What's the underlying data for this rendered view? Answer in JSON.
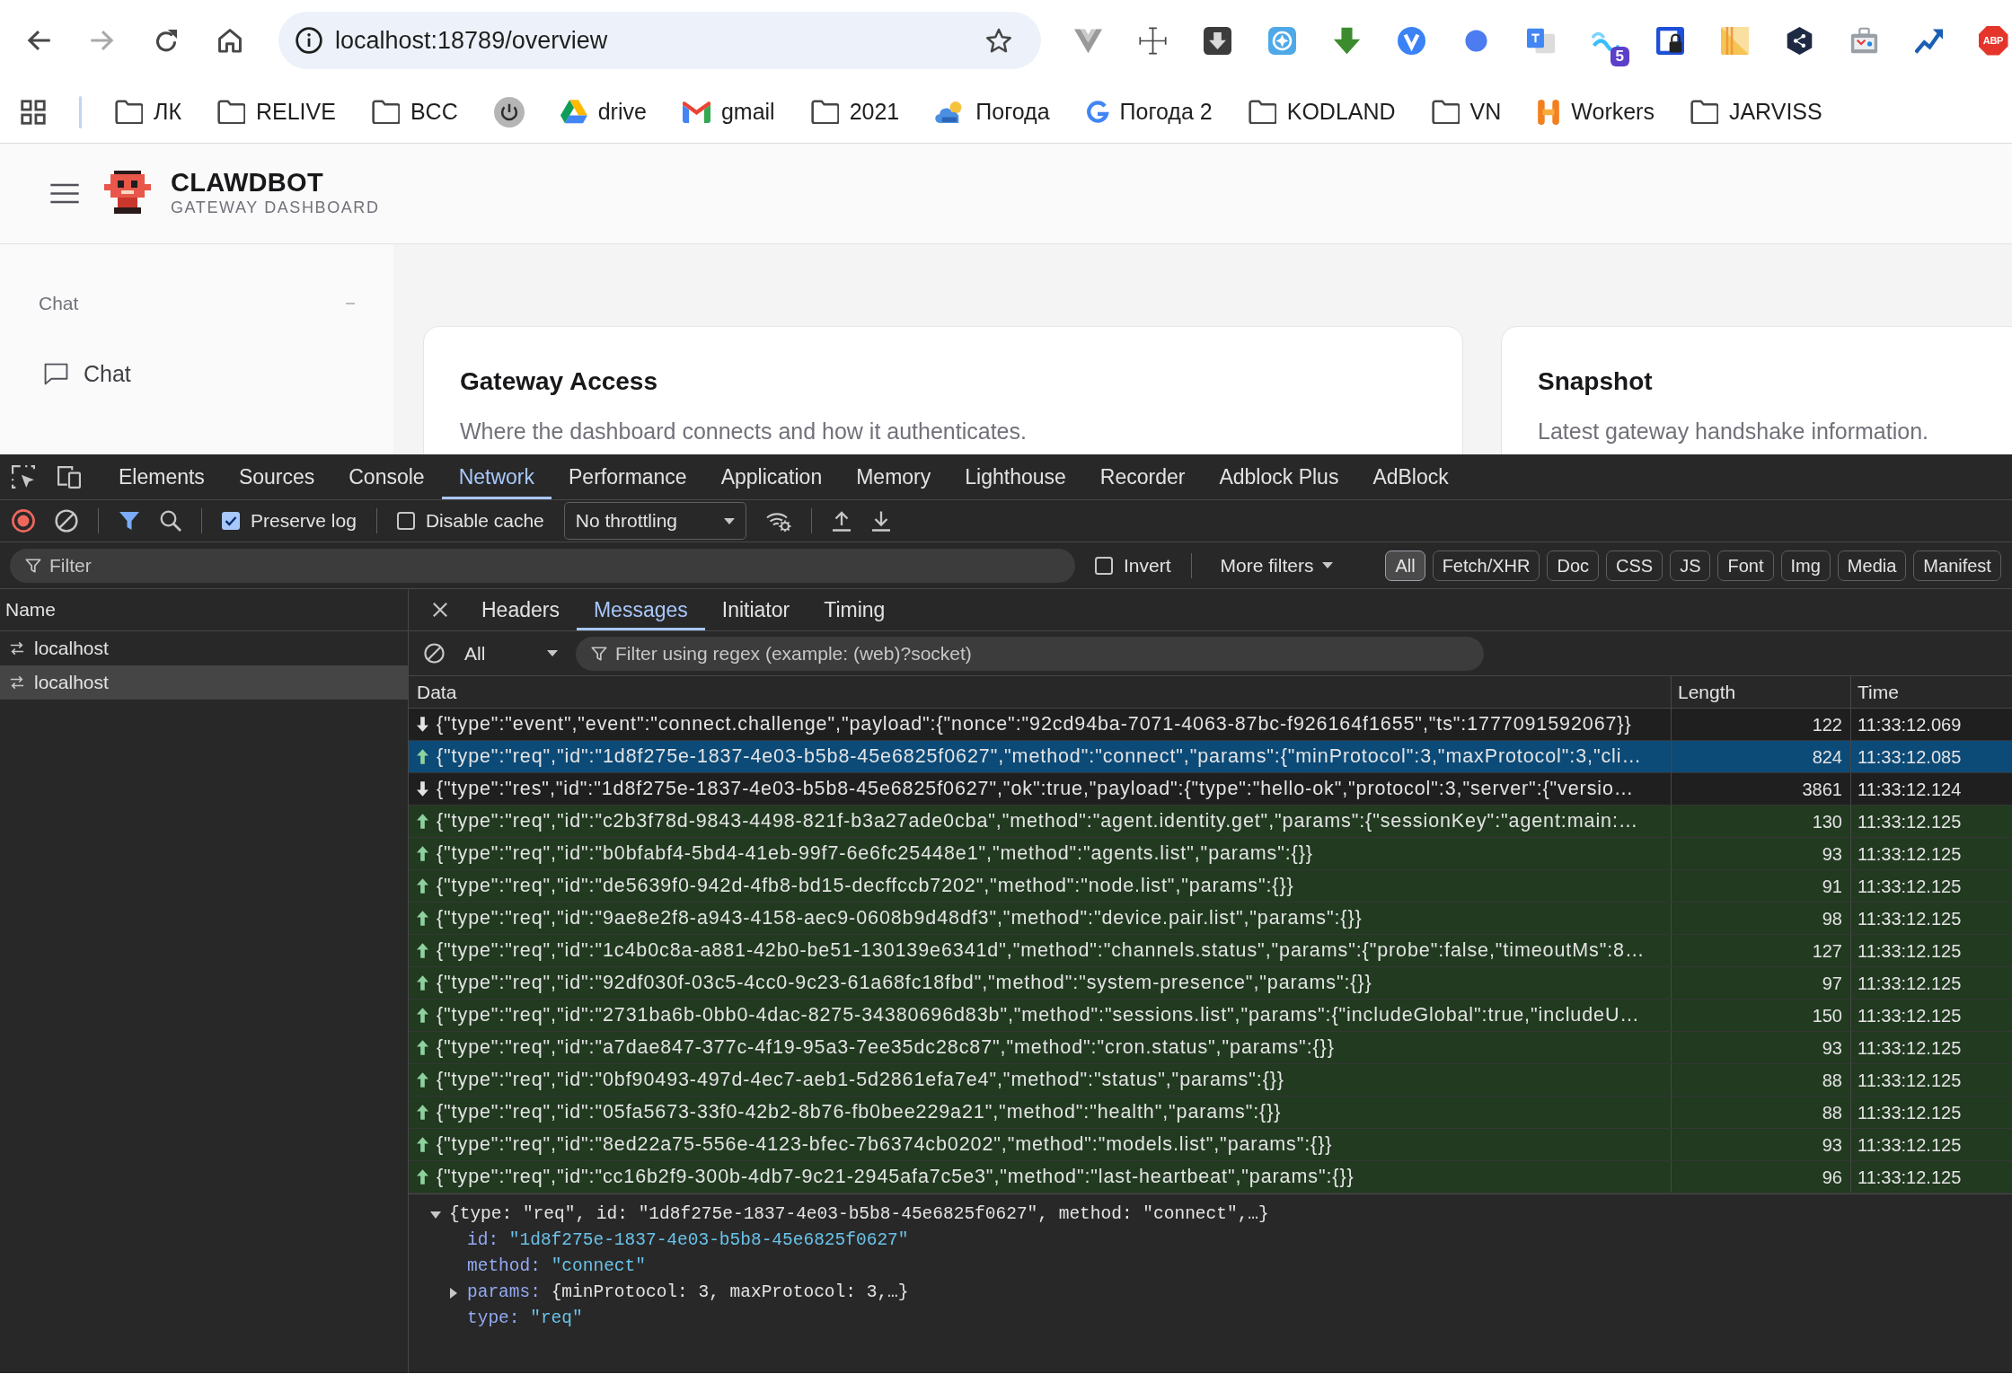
{
  "browser": {
    "url": "localhost:18789/overview",
    "extensions": [
      {
        "kind": "vue"
      },
      {
        "kind": "move"
      },
      {
        "kind": "download-box"
      },
      {
        "kind": "compass"
      },
      {
        "kind": "green-arrow"
      },
      {
        "kind": "v-circle"
      },
      {
        "kind": "blue-dot"
      },
      {
        "kind": "translate"
      },
      {
        "kind": "wave",
        "badge": "5"
      },
      {
        "kind": "lock"
      },
      {
        "kind": "notes"
      },
      {
        "kind": "hexagon"
      },
      {
        "kind": "toolbox"
      },
      {
        "kind": "chart"
      },
      {
        "kind": "abp",
        "label": "ABP"
      }
    ],
    "bookmarks": [
      {
        "kind": "folder",
        "label": "ЛК"
      },
      {
        "kind": "folder",
        "label": "RELIVE"
      },
      {
        "kind": "folder",
        "label": "BCC"
      },
      {
        "kind": "power"
      },
      {
        "kind": "drive",
        "label": "drive"
      },
      {
        "kind": "gmail",
        "label": "gmail"
      },
      {
        "kind": "folder",
        "label": "2021"
      },
      {
        "kind": "weather",
        "label": "Погода"
      },
      {
        "kind": "google",
        "label": "Погода 2"
      },
      {
        "kind": "folder",
        "label": "KODLAND"
      },
      {
        "kind": "folder",
        "label": "VN"
      },
      {
        "kind": "workers",
        "label": "Workers"
      },
      {
        "kind": "folder",
        "label": "JARVISS"
      }
    ]
  },
  "app": {
    "brand": {
      "title": "CLAWDBOT",
      "subtitle": "GATEWAY DASHBOARD"
    },
    "sidebar": {
      "groups": [
        {
          "label": "Chat",
          "expanded": true,
          "items": [
            {
              "label": "Chat",
              "selected": false
            }
          ]
        }
      ]
    },
    "cards": [
      {
        "title": "Gateway Access",
        "subtitle": "Where the dashboard connects and how it authenticates."
      },
      {
        "title": "Snapshot",
        "subtitle": "Latest gateway handshake information."
      }
    ]
  },
  "devtools": {
    "tabs": [
      {
        "label": "Elements",
        "selected": false
      },
      {
        "label": "Sources",
        "selected": false
      },
      {
        "label": "Console",
        "selected": false
      },
      {
        "label": "Network",
        "selected": true
      },
      {
        "label": "Performance",
        "selected": false
      },
      {
        "label": "Application",
        "selected": false
      },
      {
        "label": "Memory",
        "selected": false
      },
      {
        "label": "Lighthouse",
        "selected": false
      },
      {
        "label": "Recorder",
        "selected": false
      },
      {
        "label": "Adblock Plus",
        "selected": false
      },
      {
        "label": "AdBlock",
        "selected": false
      }
    ],
    "toolbar": {
      "recording": true,
      "filter_active": true,
      "checkboxes": [
        {
          "label": "Preserve log",
          "checked": true
        },
        {
          "label": "Disable cache",
          "checked": false
        }
      ],
      "throttling": "No throttling"
    },
    "filter_bar": {
      "placeholder": "Filter",
      "invert": {
        "label": "Invert",
        "checked": false
      },
      "more_filters": "More filters",
      "types": [
        {
          "label": "All",
          "selected": true
        },
        {
          "label": "Fetch/XHR",
          "selected": false
        },
        {
          "label": "Doc",
          "selected": false
        },
        {
          "label": "CSS",
          "selected": false
        },
        {
          "label": "JS",
          "selected": false
        },
        {
          "label": "Font",
          "selected": false
        },
        {
          "label": "Img",
          "selected": false
        },
        {
          "label": "Media",
          "selected": false
        },
        {
          "label": "Manifest",
          "selected": false
        }
      ]
    },
    "requests": {
      "column": "Name",
      "rows": [
        {
          "name": "localhost",
          "selected": false
        },
        {
          "name": "localhost",
          "selected": true
        }
      ]
    },
    "detail": {
      "tabs": [
        {
          "label": "Headers",
          "selected": false
        },
        {
          "label": "Messages",
          "selected": true
        },
        {
          "label": "Initiator",
          "selected": false
        },
        {
          "label": "Timing",
          "selected": false
        }
      ],
      "messages": {
        "type_filter": "All",
        "placeholder": "Filter using regex (example: (web)?socket)",
        "columns": [
          "Data",
          "Length",
          "Time"
        ],
        "rows": [
          {
            "kind": "received",
            "selected": false,
            "data": "{\"type\":\"event\",\"event\":\"connect.challenge\",\"payload\":{\"nonce\":\"92cd94ba-7071-4063-87bc-f926164f1655\",\"ts\":1777091592067}}",
            "length": "122",
            "time": "11:33:12.069"
          },
          {
            "kind": "sent",
            "selected": true,
            "data": "{\"type\":\"req\",\"id\":\"1d8f275e-1837-4e03-b5b8-45e6825f0627\",\"method\":\"connect\",\"params\":{\"minProtocol\":3,\"maxProtocol\":3,\"cli…",
            "length": "824",
            "time": "11:33:12.085"
          },
          {
            "kind": "received",
            "selected": false,
            "data": "{\"type\":\"res\",\"id\":\"1d8f275e-1837-4e03-b5b8-45e6825f0627\",\"ok\":true,\"payload\":{\"type\":\"hello-ok\",\"protocol\":3,\"server\":{\"versio…",
            "length": "3861",
            "time": "11:33:12.124"
          },
          {
            "kind": "sent",
            "selected": false,
            "data": "{\"type\":\"req\",\"id\":\"c2b3f78d-9843-4498-821f-b3a27ade0cba\",\"method\":\"agent.identity.get\",\"params\":{\"sessionKey\":\"agent:main:…",
            "length": "130",
            "time": "11:33:12.125"
          },
          {
            "kind": "sent",
            "selected": false,
            "data": "{\"type\":\"req\",\"id\":\"b0bfabf4-5bd4-41eb-99f7-6e6fc25448e1\",\"method\":\"agents.list\",\"params\":{}}",
            "length": "93",
            "time": "11:33:12.125"
          },
          {
            "kind": "sent",
            "selected": false,
            "data": "{\"type\":\"req\",\"id\":\"de5639f0-942d-4fb8-bd15-decffccb7202\",\"method\":\"node.list\",\"params\":{}}",
            "length": "91",
            "time": "11:33:12.125"
          },
          {
            "kind": "sent",
            "selected": false,
            "data": "{\"type\":\"req\",\"id\":\"9ae8e2f8-a943-4158-aec9-0608b9d48df3\",\"method\":\"device.pair.list\",\"params\":{}}",
            "length": "98",
            "time": "11:33:12.125"
          },
          {
            "kind": "sent",
            "selected": false,
            "data": "{\"type\":\"req\",\"id\":\"1c4b0c8a-a881-42b0-be51-130139e6341d\",\"method\":\"channels.status\",\"params\":{\"probe\":false,\"timeoutMs\":8…",
            "length": "127",
            "time": "11:33:12.125"
          },
          {
            "kind": "sent",
            "selected": false,
            "data": "{\"type\":\"req\",\"id\":\"92df030f-03c5-4cc0-9c23-61a68fc18fbd\",\"method\":\"system-presence\",\"params\":{}}",
            "length": "97",
            "time": "11:33:12.125"
          },
          {
            "kind": "sent",
            "selected": false,
            "data": "{\"type\":\"req\",\"id\":\"2731ba6b-0bb0-4dac-8275-34380696d83b\",\"method\":\"sessions.list\",\"params\":{\"includeGlobal\":true,\"includeU…",
            "length": "150",
            "time": "11:33:12.125"
          },
          {
            "kind": "sent",
            "selected": false,
            "data": "{\"type\":\"req\",\"id\":\"a7dae847-377c-4f19-95a3-7ee35dc28c87\",\"method\":\"cron.status\",\"params\":{}}",
            "length": "93",
            "time": "11:33:12.125"
          },
          {
            "kind": "sent",
            "selected": false,
            "data": "{\"type\":\"req\",\"id\":\"0bf90493-497d-4ec7-aeb1-5d2861efa7e4\",\"method\":\"status\",\"params\":{}}",
            "length": "88",
            "time": "11:33:12.125"
          },
          {
            "kind": "sent",
            "selected": false,
            "data": "{\"type\":\"req\",\"id\":\"05fa5673-33f0-42b2-8b76-fb0bee229a21\",\"method\":\"health\",\"params\":{}}",
            "length": "88",
            "time": "11:33:12.125"
          },
          {
            "kind": "sent",
            "selected": false,
            "data": "{\"type\":\"req\",\"id\":\"8ed22a75-556e-4123-bfec-7b6374cb0202\",\"method\":\"models.list\",\"params\":{}}",
            "length": "93",
            "time": "11:33:12.125"
          },
          {
            "kind": "sent",
            "selected": false,
            "data": "{\"type\":\"req\",\"id\":\"cc16b2f9-300b-4db7-9c21-2945afa7c5e3\",\"method\":\"last-heartbeat\",\"params\":{}}",
            "length": "96",
            "time": "11:33:12.125"
          }
        ]
      },
      "preview": {
        "summary": "{type: \"req\", id: \"1d8f275e-1837-4e03-b5b8-45e6825f0627\", method: \"connect\",…}",
        "expanded": true,
        "children": [
          {
            "kind": "string",
            "key": "id:",
            "value": "\"1d8f275e-1837-4e03-b5b8-45e6825f0627\""
          },
          {
            "kind": "string",
            "key": "method:",
            "value": "\"connect\""
          },
          {
            "kind": "object",
            "key": "params:",
            "value": "{minProtocol: 3, maxProtocol: 3,…}",
            "expanded": false
          },
          {
            "kind": "string",
            "key": "type:",
            "value": "\"req\""
          }
        ]
      }
    }
  }
}
